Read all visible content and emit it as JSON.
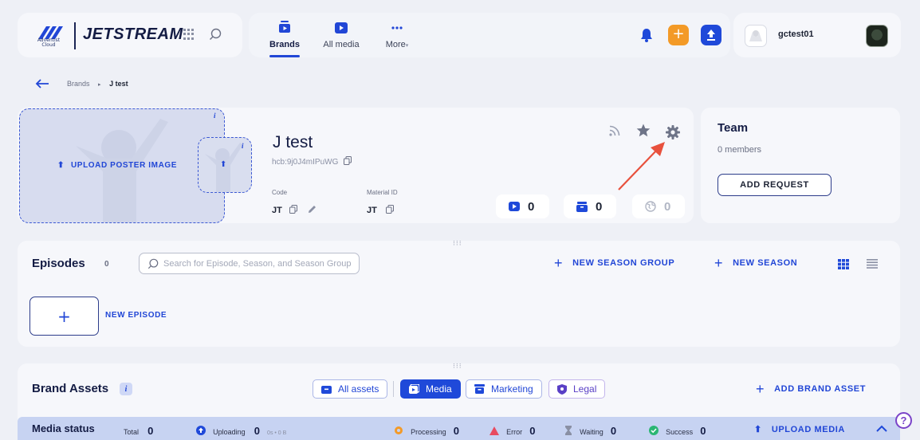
{
  "logo": {
    "brand_text": "JETSTREAM",
    "org_line1": "Adventist",
    "org_line2": "Cloud"
  },
  "nav": {
    "items": [
      {
        "label": "Brands",
        "icon": "brands-icon"
      },
      {
        "label": "All media",
        "icon": "media-play-icon"
      },
      {
        "label": "More",
        "icon": "ellipsis-icon"
      }
    ]
  },
  "user": {
    "name": "gctest01"
  },
  "colors": {
    "accent": "#2146d6",
    "orange": "#f39a27",
    "blue_btn": "#1f49d9",
    "arrow": "#e8513d"
  },
  "breadcrumb": {
    "items": [
      "Brands",
      "J test"
    ],
    "separator": "▸"
  },
  "brand": {
    "upload_label": "UPLOAD POSTER IMAGE",
    "info": "i",
    "title": "J test",
    "hcb": "hcb:9j0J4mIPuWG",
    "code_label": "Code",
    "code_value": "JT",
    "material_label": "Material ID",
    "material_value": "JT",
    "stats": [
      {
        "icon": "media-play-icon",
        "value": "0"
      },
      {
        "icon": "archive-icon",
        "value": "0"
      },
      {
        "icon": "globe-icon",
        "value": "0"
      }
    ]
  },
  "team": {
    "title": "Team",
    "members": "0 members",
    "add_request": "ADD REQUEST"
  },
  "episodes": {
    "title": "Episodes",
    "count": "0",
    "search_placeholder": "Search for Episode, Season, and Season Group",
    "new_season_group": "NEW SEASON GROUP",
    "new_season": "NEW SEASON",
    "new_episode": "NEW EPISODE",
    "new_episode_plus": "+"
  },
  "assets": {
    "title": "Brand Assets",
    "info": "i",
    "filters": [
      {
        "label": "All assets",
        "icon": "folder-icon",
        "active": false
      },
      {
        "label": "Media",
        "icon": "media-icon",
        "active": true
      },
      {
        "label": "Marketing",
        "icon": "archive-icon",
        "active": false
      },
      {
        "label": "Legal",
        "icon": "shield-icon",
        "active": false
      }
    ],
    "add_asset": "ADD BRAND ASSET"
  },
  "media_status": {
    "title": "Media status",
    "total_label": "Total",
    "total_value": "0",
    "uploading_label": "Uploading",
    "uploading_value": "0",
    "uploading_sub": "0s • 0 B",
    "processing_label": "Processing",
    "processing_value": "0",
    "error_label": "Error",
    "error_value": "0",
    "waiting_label": "Waiting",
    "waiting_value": "0",
    "success_label": "Success",
    "success_value": "0",
    "upload_media": "UPLOAD MEDIA"
  },
  "help": "?"
}
